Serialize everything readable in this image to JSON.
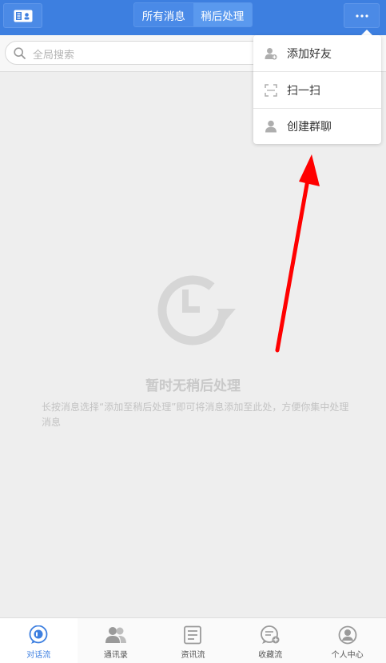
{
  "header": {
    "tabs": [
      {
        "label": "所有消息",
        "active": false
      },
      {
        "label": "稍后处理",
        "active": true
      }
    ]
  },
  "search": {
    "placeholder": "全局搜索"
  },
  "empty_state": {
    "title": "暂时无稍后处理",
    "description": "长按消息选择“添加至稍后处理”即可将消息添加至此处，方便你集中处理消息"
  },
  "menu": {
    "items": [
      {
        "label": "添加好友",
        "icon": "add-user-icon"
      },
      {
        "label": "扫一扫",
        "icon": "scan-icon"
      },
      {
        "label": "创建群聊",
        "icon": "user-icon"
      }
    ]
  },
  "bottom_nav": {
    "items": [
      {
        "label": "对话流",
        "icon": "chat-icon",
        "active": true
      },
      {
        "label": "通讯录",
        "icon": "contacts-icon",
        "active": false
      },
      {
        "label": "资讯流",
        "icon": "news-icon",
        "active": false
      },
      {
        "label": "收藏流",
        "icon": "favorites-icon",
        "active": false
      },
      {
        "label": "个人中心",
        "icon": "profile-icon",
        "active": false
      }
    ]
  },
  "colors": {
    "accent": "#3d7fe0",
    "annotation": "#ff0000"
  }
}
